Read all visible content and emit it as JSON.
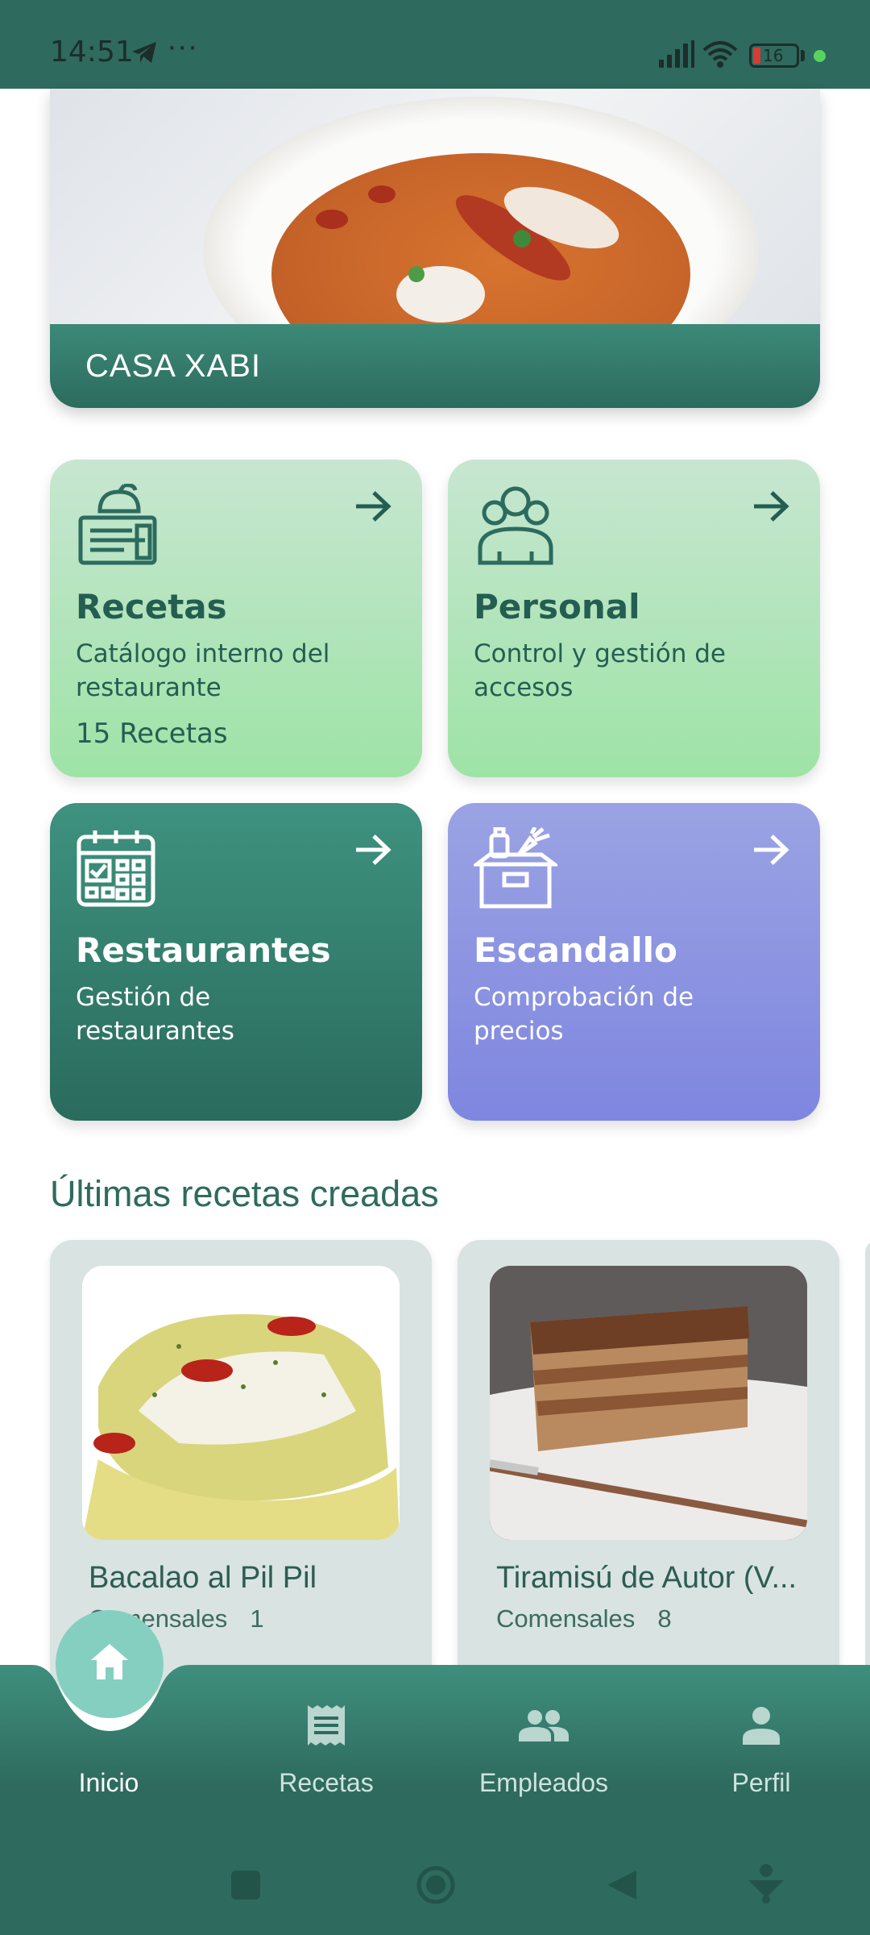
{
  "status_bar": {
    "time": "14:51",
    "battery_level": "16",
    "icons": [
      "telegram-icon",
      "more-dots-icon",
      "signal-icon",
      "wifi-icon",
      "battery-icon",
      "active-dot-icon"
    ]
  },
  "hero": {
    "title": "CASA XABI"
  },
  "tiles": [
    {
      "title": "Recetas",
      "description": "Catálogo interno del restaurante",
      "count": "15 Recetas",
      "icon": "recipe-book-icon"
    },
    {
      "title": "Personal",
      "description": "Control y gestión de accesos",
      "icon": "staff-group-icon"
    },
    {
      "title": "Restaurantes",
      "description": "Gestión de restaurantes",
      "icon": "calendar-icon"
    },
    {
      "title": "Escandallo",
      "description": "Comprobación de precios",
      "icon": "grocery-box-icon"
    }
  ],
  "section": {
    "latest_title": "Últimas recetas creadas"
  },
  "recipes": [
    {
      "name": "Bacalao al Pil Pil",
      "servings_label": "Comensales",
      "servings": "1"
    },
    {
      "name": "Tiramisú de Autor (V...",
      "servings_label": "Comensales",
      "servings": "8"
    }
  ],
  "nav": {
    "items": [
      {
        "label": "Inicio",
        "icon": "home-icon",
        "active": true
      },
      {
        "label": "Recetas",
        "icon": "receipt-icon"
      },
      {
        "label": "Empleados",
        "icon": "people-icon"
      },
      {
        "label": "Perfil",
        "icon": "person-icon"
      }
    ]
  },
  "colors": {
    "primary": "#2e6a5e",
    "tile_green": "#9ee3a6",
    "tile_teal": "#2a6b5c",
    "tile_purple": "#7f86e0",
    "fab": "#85cfc1"
  }
}
